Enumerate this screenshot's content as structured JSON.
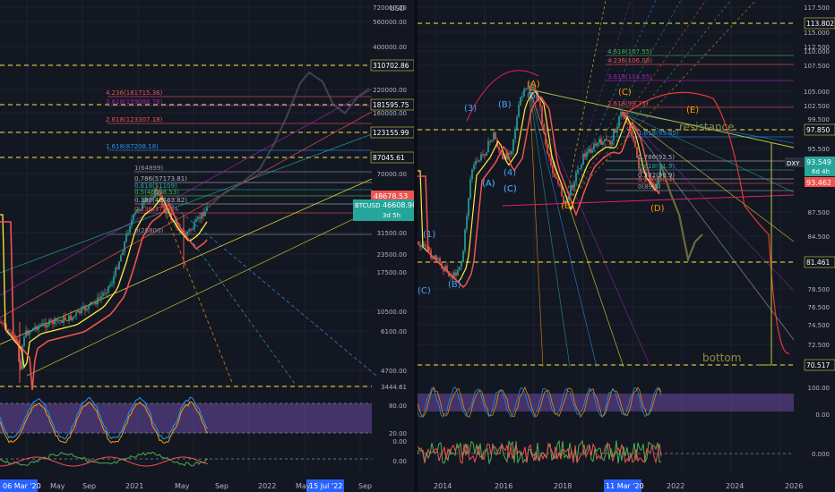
{
  "left_chart": {
    "symbol_tag": "BTCUSD",
    "currency": "USD",
    "countdown": "3d 5h",
    "price_label": "46608.90",
    "secondary_price": "48678.53",
    "price_axis": [
      "720000.00",
      "560000.00",
      "400000.00",
      "310000.00",
      "220000.00",
      "160000.00",
      "120000.00",
      "70000.00",
      "50000.00",
      "31500.00",
      "23500.00",
      "17500.00",
      "10500.00",
      "6100.00",
      "4700.00",
      "3444.61"
    ],
    "levels": [
      {
        "value": "310702.86",
        "color": "#ffeb3b"
      },
      {
        "value": "181595.75",
        "color": "#ffeb3b"
      },
      {
        "value": "123155.99",
        "color": "#ffeb3b"
      },
      {
        "value": "87045.61",
        "color": "#ffeb3b"
      }
    ],
    "fib_labels": [
      {
        "text": "4.236(181715.36)",
        "color": "#ef5350"
      },
      {
        "text": "3.618(159088.78)",
        "color": "#9c27b0"
      },
      {
        "text": "2.618(123307.18)",
        "color": "#ef5350"
      },
      {
        "text": "1.618(87208.18)",
        "color": "#2196f3"
      },
      {
        "text": "1(64899)",
        "color": "#9598a1"
      },
      {
        "text": "0.786(57173.81)",
        "color": "#b2b5be"
      },
      {
        "text": "0.618(51109)",
        "color": "#26a69a"
      },
      {
        "text": "0.5(46598.53)",
        "color": "#4caf50"
      },
      {
        "text": "0.382(42583.82)",
        "color": "#b2b5be"
      },
      {
        "text": "0.236(37535)",
        "color": "#ef5350"
      },
      {
        "text": "0(28800)",
        "color": "#9598a1"
      }
    ],
    "stoch_axis": [
      "80.00",
      "20.00"
    ],
    "macd_axis": [
      "0.00",
      "0.00"
    ],
    "time_axis": [
      "May",
      "Sep",
      "2021",
      "May",
      "Sep",
      "2022",
      "May",
      "Sep"
    ],
    "time_highlight_start": "06 Mar '20",
    "time_highlight_end": "15 Jul '22"
  },
  "right_chart": {
    "symbol_tag": "DXY",
    "countdown": "6d 4h",
    "price_label": "93.549",
    "secondary_price": "93.462",
    "price_axis": [
      "117.500",
      "115.000",
      "112.500",
      "110.000",
      "107.500",
      "105.000",
      "102.500",
      "99.500",
      "97.500",
      "95.500",
      "87.500",
      "84.500",
      "81.461",
      "78.500",
      "76.500",
      "74.500",
      "72.500",
      "70.517"
    ],
    "levels": [
      {
        "value": "113.802",
        "color": "#ffeb3b"
      },
      {
        "value": "97.850",
        "color": "#ffeb3b"
      },
      {
        "value": "81.461",
        "color": "#ffeb3b"
      },
      {
        "value": "70.517",
        "color": "#ffeb3b"
      }
    ],
    "fib_labels": [
      {
        "text": "4.618(107.55)",
        "color": "#4caf50"
      },
      {
        "text": "4.236(106.08)",
        "color": "#ef5350"
      },
      {
        "text": "3.618(103.65)",
        "color": "#9c27b0"
      },
      {
        "text": "2.618(99.75)",
        "color": "#ef5350"
      },
      {
        "text": "1.618(95.85)",
        "color": "#2196f3"
      },
      {
        "text": "0.786(92.5)",
        "color": "#b2b5be"
      },
      {
        "text": "0.618(91.9)",
        "color": "#26a69a"
      },
      {
        "text": "0.382(90.9)",
        "color": "#b2b5be"
      },
      {
        "text": "0.236(90.4)",
        "color": "#ef5350"
      },
      {
        "text": "0(89.5)",
        "color": "#9598a1"
      }
    ],
    "wave_labels": [
      {
        "text": "(3)",
        "color": "#42a5f5"
      },
      {
        "text": "(B)",
        "color": "#42a5f5"
      },
      {
        "text": "(5)",
        "color": "#42a5f5"
      },
      {
        "text": "(A)",
        "color": "#42a5f5"
      },
      {
        "text": "(C)",
        "color": "#42a5f5"
      },
      {
        "text": "(4)",
        "color": "#42a5f5"
      },
      {
        "text": "(A)",
        "color": "#42a5f5"
      },
      {
        "text": "(C)",
        "color": "#42a5f5"
      },
      {
        "text": "(A)",
        "color": "#ff9800"
      },
      {
        "text": "(C)",
        "color": "#ff9800"
      },
      {
        "text": "(B)",
        "color": "#ff9800"
      },
      {
        "text": "(D)",
        "color": "#ff9800"
      },
      {
        "text": "(E)",
        "color": "#ff9800"
      },
      {
        "text": "(B)",
        "color": "#42a5f5"
      },
      {
        "text": "(1)",
        "color": "#42a5f5"
      },
      {
        "text": "(C)",
        "color": "#42a5f5"
      }
    ],
    "annotations": {
      "resistance": "resistance",
      "bottom": "bottom"
    },
    "stoch_axis": [
      "100.00",
      "0.00"
    ],
    "macd_axis": [
      "0.000"
    ],
    "time_axis": [
      "2014",
      "2016",
      "2018",
      "2022",
      "2024",
      "2026"
    ],
    "time_highlight": "11 Mar '20"
  },
  "colors": {
    "background": "#131722",
    "grid": "#1e222d",
    "up": "#26a69a",
    "down": "#ef5350",
    "level": "#ffeb3b",
    "stoch_band": "#7e57c2",
    "axis_text": "#b2b5be"
  }
}
